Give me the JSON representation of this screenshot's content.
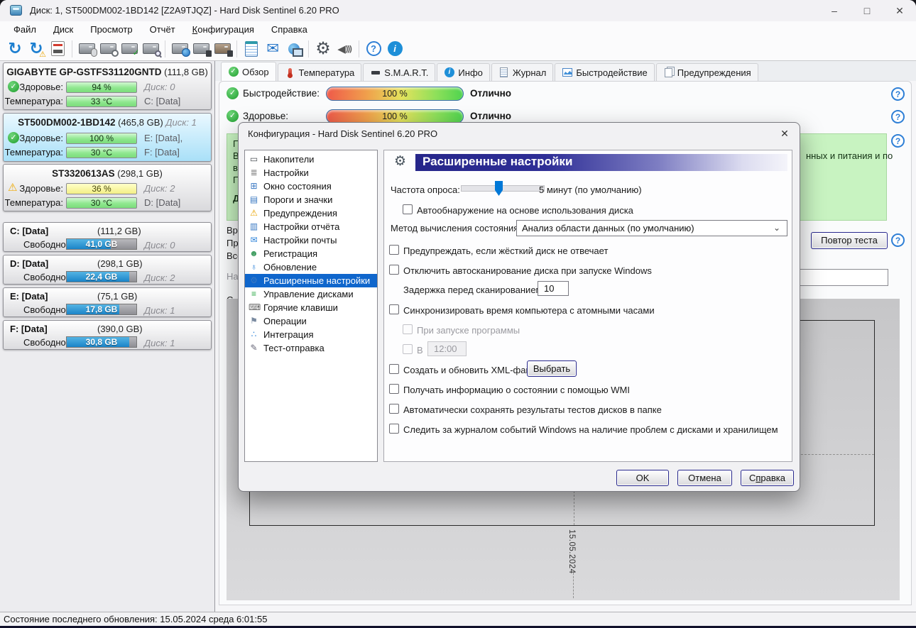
{
  "window": {
    "title": "Диск: 1, ST500DM002-1BD142 [Z2A9TJQZ]  -  Hard Disk Sentinel 6.20 PRO",
    "minimize": "–",
    "maximize": "□",
    "close": "✕"
  },
  "menu": {
    "file": "Файл",
    "disk": "Диск",
    "view": "Просмотр",
    "report": "Отчёт",
    "cfg_key": "К",
    "cfg_rest": "онфигурация",
    "help": "Справка"
  },
  "sidebar": {
    "disks": [
      {
        "name": "GIGABYTE GP-GSTFS31120GNTD",
        "size": "(111,8 GB)",
        "suffix": "",
        "health_label": "Здоровье:",
        "health_value": "94 %",
        "row1_right": "Диск: 0",
        "temp_label": "Температура:",
        "temp_value": "33 °C",
        "row2_right": "C: [Data]"
      },
      {
        "name": "ST500DM002-1BD142",
        "size": "(465,8 GB)",
        "suffix": "Диск: 1",
        "health_label": "Здоровье:",
        "health_value": "100 %",
        "row1_right": "E: [Data],",
        "temp_label": "Температура:",
        "temp_value": "30 °C",
        "row2_right": "F: [Data]"
      },
      {
        "name": "ST3320613AS",
        "size": "(298,1 GB)",
        "suffix": "",
        "health_label": "Здоровье:",
        "health_value": "36 %",
        "row1_right": "Диск: 2",
        "temp_label": "Температура:",
        "temp_value": "30 °C",
        "row2_right": "D: [Data]"
      }
    ],
    "partitions": [
      {
        "name": "C: [Data]",
        "size": "(111,2 GB)",
        "free_label": "Свободно",
        "free_value": "41,0 GB",
        "right": "Диск: 0"
      },
      {
        "name": "D: [Data]",
        "size": "(298,1 GB)",
        "free_label": "Свободно",
        "free_value": "22,4 GB",
        "right": "Диск: 2"
      },
      {
        "name": "E: [Data]",
        "size": "(75,1 GB)",
        "free_label": "Свободно",
        "free_value": "17,8 GB",
        "right": "Диск: 1"
      },
      {
        "name": "F: [Data]",
        "size": "(390,0 GB)",
        "free_label": "Свободно",
        "free_value": "30,8 GB",
        "right": "Диск: 1"
      }
    ]
  },
  "tabs": [
    {
      "label": "Обзор"
    },
    {
      "label": "Температура"
    },
    {
      "label": "S.M.A.R.T."
    },
    {
      "label": "Инфо"
    },
    {
      "label": "Журнал"
    },
    {
      "label": "Быстродействие"
    },
    {
      "label": "Предупреждения"
    }
  ],
  "overview": {
    "rows": [
      {
        "label": "Быстродействие:",
        "value": "100 %",
        "rating": "Отлично"
      },
      {
        "label": "Здоровье:",
        "value": "100 %",
        "rating": "Отлично"
      }
    ],
    "green_fragments": {
      "l1": "Пр",
      "l2": "В с",
      "l3": "воз",
      "l4": "По",
      "l5": "Де",
      "right": "нных и питания и по"
    },
    "status_fragments": {
      "s1": "Вре",
      "s2": "При",
      "s3": "Все",
      "s4": "На",
      "s5": "С"
    },
    "retest_button": "Повтор теста",
    "chart_date": "15.05.2024"
  },
  "dialog": {
    "title": "Конфигурация  -  Hard Disk Sentinel 6.20 PRO",
    "close": "✕",
    "nav": [
      {
        "label": "Накопители"
      },
      {
        "label": "Настройки"
      },
      {
        "label": "Окно состояния"
      },
      {
        "label": "Пороги и значки"
      },
      {
        "label": "Предупреждения"
      },
      {
        "label": "Настройки отчёта"
      },
      {
        "label": "Настройки почты"
      },
      {
        "label": "Регистрация"
      },
      {
        "label": "Обновление"
      },
      {
        "label": "Расширенные настройки"
      },
      {
        "label": "Управление дисками"
      },
      {
        "label": "Горячие клавиши"
      },
      {
        "label": "Операции"
      },
      {
        "label": "Интеграция"
      },
      {
        "label": "Тест-отправка"
      }
    ],
    "panel": {
      "header": "Расширенные настройки",
      "poll_label": "Частота опроса:",
      "poll_value": "5 минут (по умолчанию)",
      "cb_autodetect": "Автообнаружение на основе использования диска",
      "method_label": "Метод вычисления состояния:",
      "method_value": "Анализ области данных (по умолчанию)",
      "cb_warn": "Предупреждать, если жёсткий диск не отвечает",
      "cb_disable_autoscan": "Отключить автосканирование диска при запуске Windows",
      "delay_label": "Задержка перед сканированием (сек):",
      "delay_value": "10",
      "cb_sync": "Синхронизировать время компьютера с атомными часами",
      "cb_on_start": "При запуске программы",
      "cb_at": "В",
      "at_value": "12:00",
      "cb_xml": "Создать и обновить XML-файл",
      "choose_button": "Выбрать",
      "cb_wmi": "Получать информацию о состоянии с помощью WMI",
      "cb_autosave": "Автоматически сохранять результаты тестов дисков в папке",
      "cb_eventlog": "Следить за журналом событий Windows на наличие проблем с дисками и хранилищем"
    },
    "buttons": {
      "ok": "OK",
      "cancel": "Отмена",
      "help_pre": "С",
      "help_key": "п",
      "help_rest": "равка"
    }
  },
  "statusbar": {
    "text": "Состояние последнего обновления: 15.05.2024 среда 6:01:55"
  }
}
